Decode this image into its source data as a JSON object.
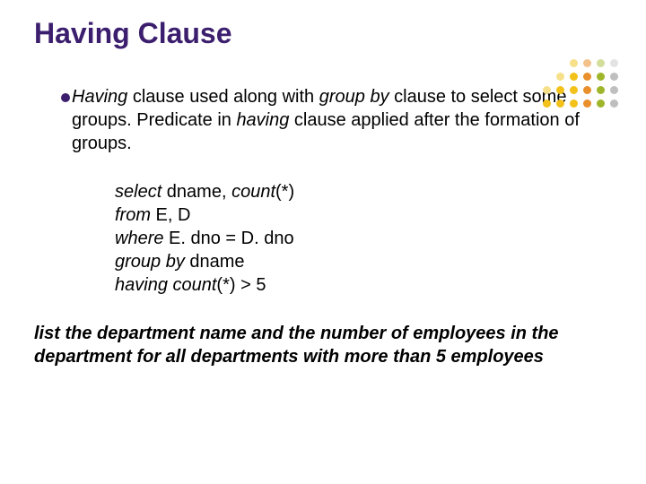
{
  "title": "Having Clause",
  "para1": {
    "seg1": "Having",
    "seg2": " clause used along with ",
    "seg3": "group by",
    "seg4": " clause to select some groups. Predicate in ",
    "seg5": "having",
    "seg6": " clause applied after the formation of groups."
  },
  "code": {
    "l1a": "select",
    "l1b": " dname, ",
    "l1c": "count",
    "l1d": "(*)",
    "l2a": "from",
    "l2b": " E, D",
    "l3a": "where",
    "l3b": " E. dno = D. dno",
    "l4a": "group by",
    "l4b": " dname",
    "l5a": "having count",
    "l5b": "(*) > 5"
  },
  "summary": "list the department name and the number of employees in the department for all departments with more than 5 employees"
}
